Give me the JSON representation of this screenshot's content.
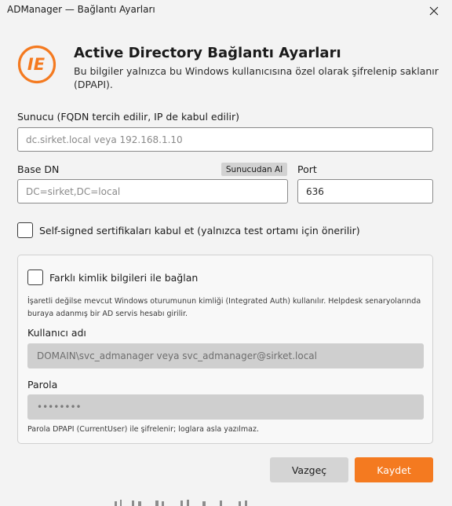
{
  "window": {
    "title": "ADManager — Bağlantı Ayarları"
  },
  "colors": {
    "accent": "#f47a20",
    "logo": "#f47a20"
  },
  "logo": {
    "text": "IE",
    "icon": "brand-logo"
  },
  "header": {
    "title": "Active Directory Bağlantı Ayarları",
    "subtitle": "Bu bilgiler yalnızca bu Windows kullanıcısına özel olarak şifrelenip saklanır (DPAPI)."
  },
  "server": {
    "label": "Sunucu (FQDN tercih edilir, IP de kabul edilir)",
    "placeholder": "dc.sirket.local veya 192.168.1.10",
    "value": ""
  },
  "base_dn": {
    "label": "Base DN",
    "button": "Sunucudan Al",
    "placeholder": "DC=sirket,DC=local",
    "value": ""
  },
  "port": {
    "label": "Port",
    "value": "636"
  },
  "self_signed": {
    "label": "Self-signed sertifikaları kabul et (yalnızca test ortamı için önerilir)",
    "checked": false
  },
  "credentials": {
    "checkbox_label": "Farklı kimlik bilgileri ile bağlan",
    "checked": false,
    "hint": "İşaretli değilse mevcut Windows oturumunun kimliği (Integrated Auth) kullanılır. Helpdesk senaryolarında buraya adanmış bir AD servis hesabı girilir.",
    "username_label": "Kullanıcı adı",
    "username_placeholder": "DOMAIN\\svc_admanager veya svc_admanager@sirket.local",
    "password_label": "Parola",
    "password_value": "••••••••",
    "password_hint": "Parola DPAPI (CurrentUser) ile şifrelenir; loglara asla yazılmaz."
  },
  "actions": {
    "cancel": "Vazgeç",
    "save": "Kaydet"
  }
}
